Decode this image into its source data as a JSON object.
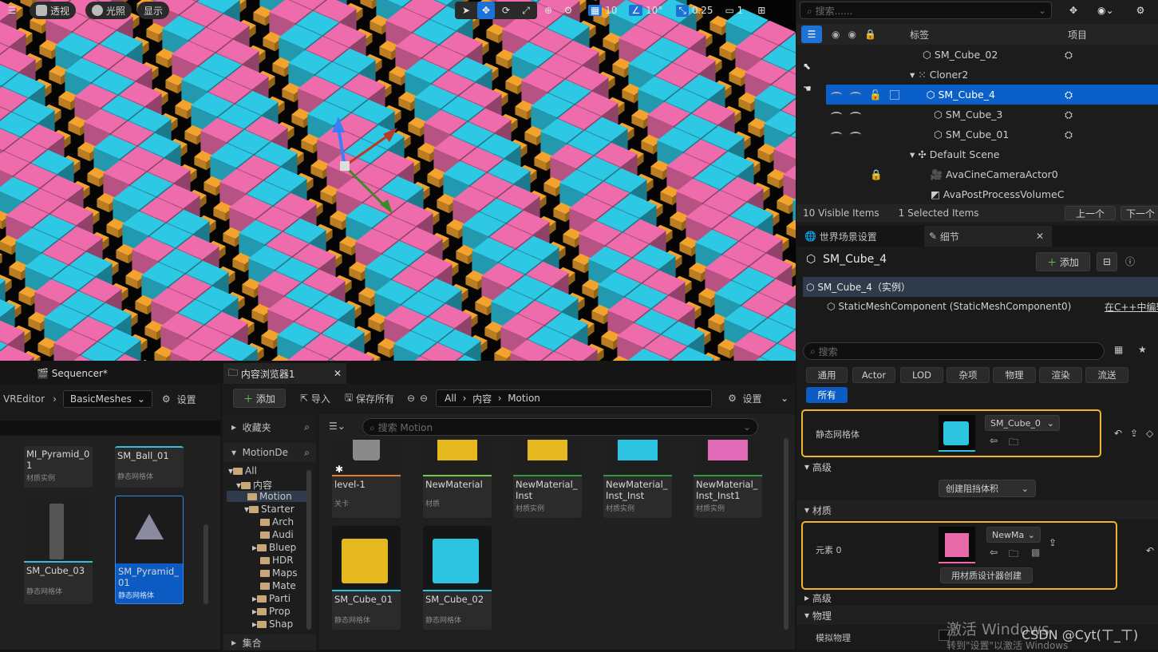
{
  "viewport": {
    "perspective": "透视",
    "lighting": "光照",
    "show": "显示",
    "grid_snap": "10",
    "rot_snap": "10°",
    "scale_snap": "0.25",
    "camera_speed": "1",
    "colors": {
      "pink": "#e96aa8",
      "cyan": "#2cc4e0",
      "orange": "#eea02c"
    }
  },
  "outliner": {
    "search_placeholder": "搜索......",
    "col_label": "标签",
    "col_item": "项目",
    "items": [
      {
        "label": "SM_Cube_02"
      },
      {
        "label": "Cloner2"
      },
      {
        "label": "SM_Cube_4"
      },
      {
        "label": "SM_Cube_3"
      },
      {
        "label": "SM_Cube_01"
      },
      {
        "label": "Default Scene"
      },
      {
        "label": "AvaCineCameraActor0"
      },
      {
        "label": "AvaPostProcessVolumeC"
      }
    ],
    "visible": "10 Visible Items",
    "selected": "1 Selected Items",
    "prev": "上一个",
    "next": "下一个"
  },
  "details": {
    "tab_world": "世界场景设置",
    "tab_details": "细节",
    "object_name": "SM_Cube_4",
    "add": "添加",
    "instance": "SM_Cube_4（实例）",
    "component": "StaticMeshComponent (StaticMeshComponent0)",
    "edit_cpp": "在C++中编辑",
    "search_placeholder": "搜索",
    "categories": [
      "通用",
      "Actor",
      "LOD",
      "杂项",
      "物理",
      "渲染",
      "流送",
      "所有"
    ],
    "static_mesh_label": "静态网格体",
    "static_mesh_value": "SM_Cube_0",
    "advanced": "高级",
    "create_collision": "创建阻挡体积",
    "material_section": "材质",
    "element0": "元素 0",
    "material_value": "NewMa",
    "create_with_designer": "用材质设计器创建",
    "advanced2": "高级",
    "physics": "物理",
    "simulate_physics": "模拟物理"
  },
  "sequencer": {
    "title": "Sequencer*",
    "crumb1": "VREditor",
    "crumb2": "BasicMeshes",
    "settings": "设置",
    "assets": [
      {
        "name": "MI_Pyramid_01",
        "type": "材质实例"
      },
      {
        "name": "SM_Ball_01",
        "type": "静态网格体"
      },
      {
        "name": "SM_Cube_03",
        "type": "静态网格体"
      },
      {
        "name": "SM_Pyramid_01",
        "type": "静态网格体"
      }
    ]
  },
  "content_browser": {
    "title": "内容浏览器1",
    "add": "添加",
    "import": "导入",
    "save_all": "保存所有",
    "path_all": "All",
    "path_content": "内容",
    "path_motion": "Motion",
    "settings": "设置",
    "favorites": "收藏夹",
    "root": "MotionDe",
    "tree": [
      "All",
      "内容",
      "Motion",
      "Starter",
      "Arch",
      "Audi",
      "Bluep",
      "HDR",
      "Maps",
      "Mate",
      "Parti",
      "Prop",
      "Shap"
    ],
    "collections": "集合",
    "search_placeholder": "搜索 Motion",
    "assets": [
      {
        "name": "level-1",
        "type": "关卡"
      },
      {
        "name": "NewMaterial",
        "type": "材质"
      },
      {
        "name": "NewMaterial_Inst",
        "type": "材质实例"
      },
      {
        "name": "NewMaterial_Inst_Inst",
        "type": "材质实例"
      },
      {
        "name": "NewMaterial_Inst_Inst1",
        "type": "材质实例"
      },
      {
        "name": "SM_Cube_01",
        "type": "静态网格体"
      },
      {
        "name": "SM_Cube_02",
        "type": "静态网格体"
      }
    ]
  },
  "watermark": {
    "activate": "激活 Windows",
    "csdn": "CSDN @Cyt(ㄒ_ㄒ)",
    "goto": "转到\"设置\"以激活 Windows"
  }
}
